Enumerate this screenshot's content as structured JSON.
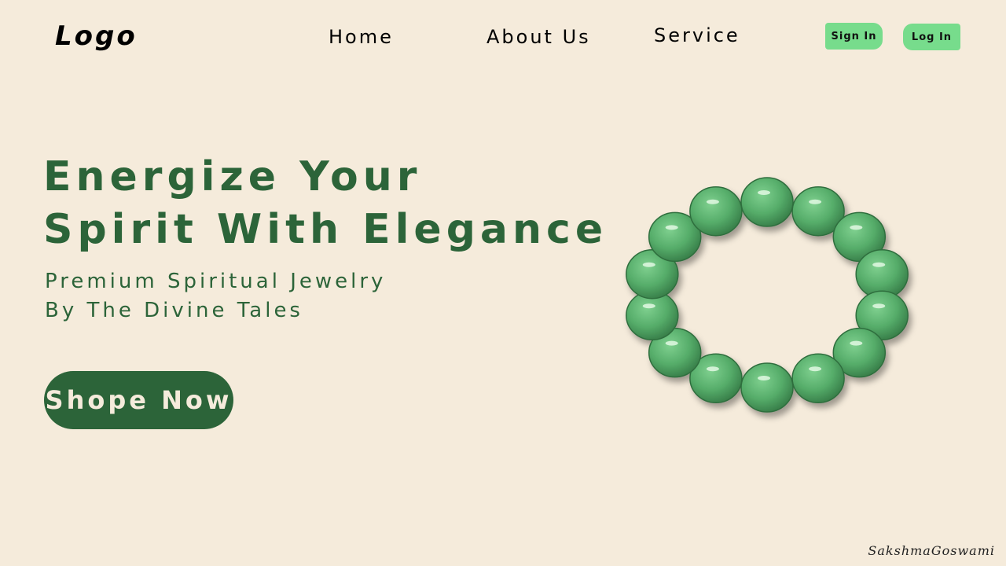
{
  "header": {
    "logo": "Logo",
    "nav": {
      "home": "Home",
      "about": "About Us",
      "service": "Service"
    },
    "sign_in": "Sign In",
    "log_in": "Log In"
  },
  "hero": {
    "headline_line1": "Energize Your",
    "headline_line2": "Spirit With Elegance",
    "subtitle_line1": "Premium Spiritual Jewelry",
    "subtitle_line2": "By The Divine Tales",
    "cta": "Shope Now"
  },
  "image": {
    "icon": "jade-bead-bracelet"
  },
  "footer": {
    "signature": "SakshmaGoswami"
  },
  "colors": {
    "background": "#f5ebdb",
    "brand_green": "#2c6439",
    "button_green": "#77dc8c",
    "bead_green": "#5bb36f"
  }
}
